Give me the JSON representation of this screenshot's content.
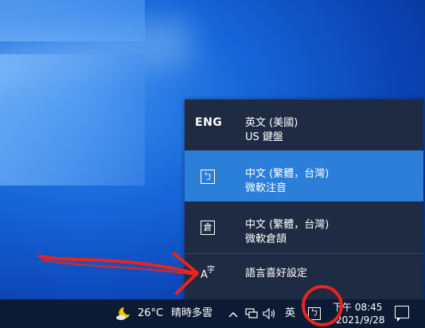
{
  "language_flyout": {
    "items": [
      {
        "code": "ENG",
        "name": "英文 (美國)",
        "keyboard": "US 鍵盤",
        "selected": false
      },
      {
        "icon_text": "ㄅ",
        "name": "中文 (繁體，台灣)",
        "keyboard": "微軟注音",
        "selected": true
      },
      {
        "icon_text": "倉",
        "name": "中文 (繁體，台灣)",
        "keyboard": "微軟倉頡",
        "selected": false
      }
    ],
    "settings_label": "語言喜好設定",
    "settings_icon": {
      "a": "A",
      "zi": "字"
    }
  },
  "taskbar": {
    "weather_icon": "moon-cloud-icon",
    "weather_temp": "26°C",
    "weather_desc": "晴時多雲",
    "chevron": "^",
    "ime_mode": "英",
    "ime_icon_text": "ㄅ",
    "clock_time": "下午 08:45",
    "clock_date": "2021/9/28"
  },
  "colors": {
    "flyout_bg": "#1f2b42",
    "selected_bg": "#2b7fd8",
    "taskbar_bg": "#0d1a33",
    "annotation": "#e8241f"
  }
}
